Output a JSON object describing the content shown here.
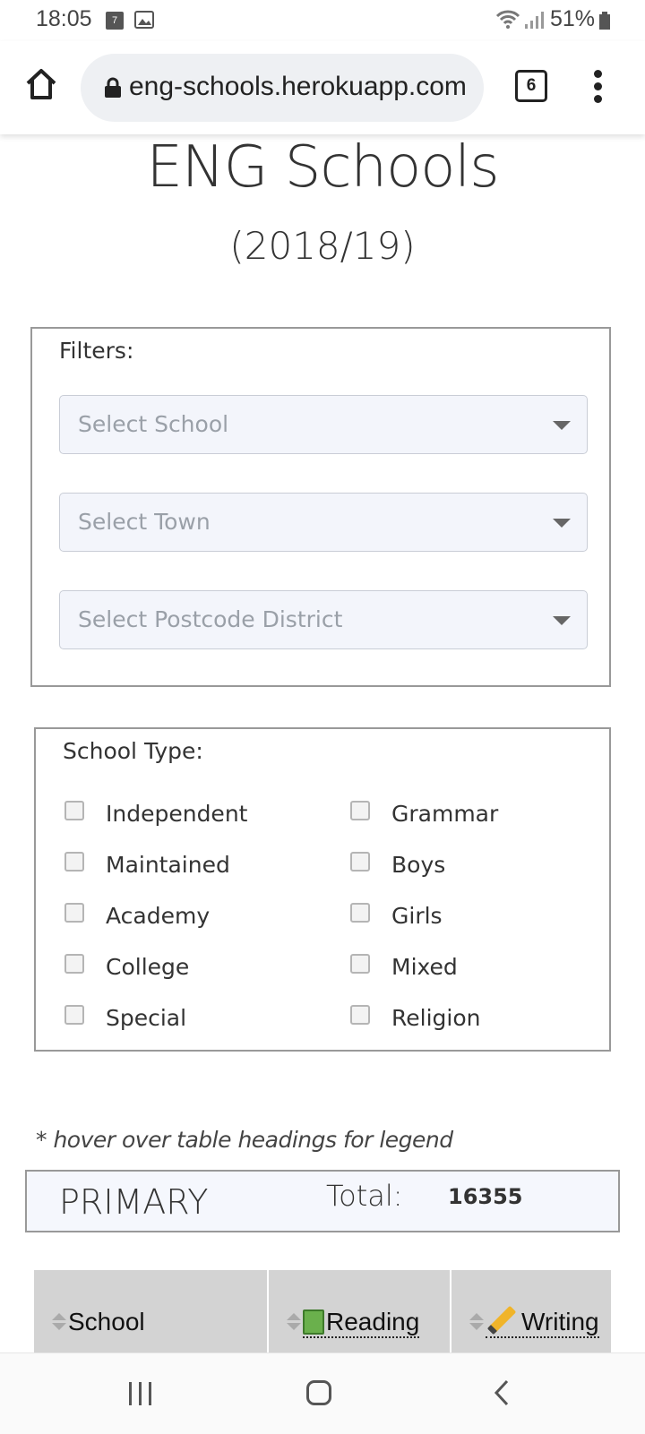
{
  "status_bar": {
    "time": "18:05",
    "calendar_badge": "7",
    "battery": "51%"
  },
  "browser": {
    "url": "eng-schools.herokuapp.com",
    "tab_count": "6"
  },
  "page": {
    "title": "ENG Schools",
    "subtitle": "(2018/19)"
  },
  "filters": {
    "label": "Filters:",
    "school_placeholder": "Select School",
    "town_placeholder": "Select Town",
    "postcode_placeholder": "Select Postcode District"
  },
  "school_type": {
    "label": "School Type:",
    "left": [
      "Independent",
      "Maintained",
      "Academy",
      "College",
      "Special"
    ],
    "right": [
      "Grammar",
      "Boys",
      "Girls",
      "Mixed",
      "Religion"
    ]
  },
  "legend_hint": "* hover over table headings for legend",
  "summary": {
    "phase": "PRIMARY",
    "total_label": "Total:",
    "total_value": "16355"
  },
  "table": {
    "headers": [
      "School",
      "Reading",
      "Writing"
    ]
  }
}
